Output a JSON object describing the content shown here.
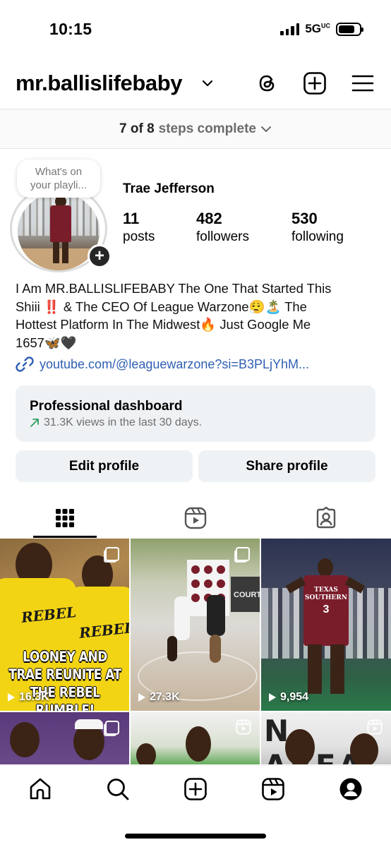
{
  "status_bar": {
    "time": "10:15",
    "network": "5G",
    "network_sup": "UC"
  },
  "header": {
    "username": "mr.ballislifebaby",
    "icons": [
      "chevron-down-icon",
      "threads-icon",
      "create-icon",
      "menu-icon"
    ]
  },
  "steps": {
    "done": "7 of 8",
    "rest": "steps complete"
  },
  "profile": {
    "note_line1": "What's on",
    "note_line2": "your playli...",
    "display_name": "Trae Jefferson",
    "posts_count": "11",
    "posts_label": "posts",
    "followers_count": "482",
    "followers_label": "followers",
    "following_count": "530",
    "following_label": "following",
    "bio_line1": "I Am MR.BALLISLIFEBABY The One That Started This",
    "bio_line2_a": "Shiii ",
    "bio_line2_emo": "‼️",
    "bio_line2_b": " & The CEO Of League Warzone😮‍💨🏝️ The",
    "bio_line3": "Hottest Platform In The Midwest🔥 Just Google Me",
    "bio_line4": "1657🦋🖤",
    "link": "youtube.com/@leaguewarzone?si=B3PLjYhM..."
  },
  "dashboard": {
    "title": "Professional dashboard",
    "subtitle": "31.3K views in the last 30 days."
  },
  "buttons": {
    "edit": "Edit profile",
    "share": "Share profile"
  },
  "grid": {
    "tiles": [
      {
        "caption": "LOONEY AND TRAE REUNITE AT THE REBEL RUMBLE!",
        "shirt_text": "REBEL",
        "views": "16.3K"
      },
      {
        "views": "27.3K",
        "banner_text": "COURTS"
      },
      {
        "views": "9,954",
        "jersey_text": "TEXAS SOUTHERN",
        "jersey_number": "3"
      },
      {},
      {},
      {
        "banner_text": "N AREA"
      }
    ]
  },
  "colors": {
    "link": "#2f5fb3",
    "trend": "#2e9e5e",
    "button_bg": "#eff2f4"
  }
}
